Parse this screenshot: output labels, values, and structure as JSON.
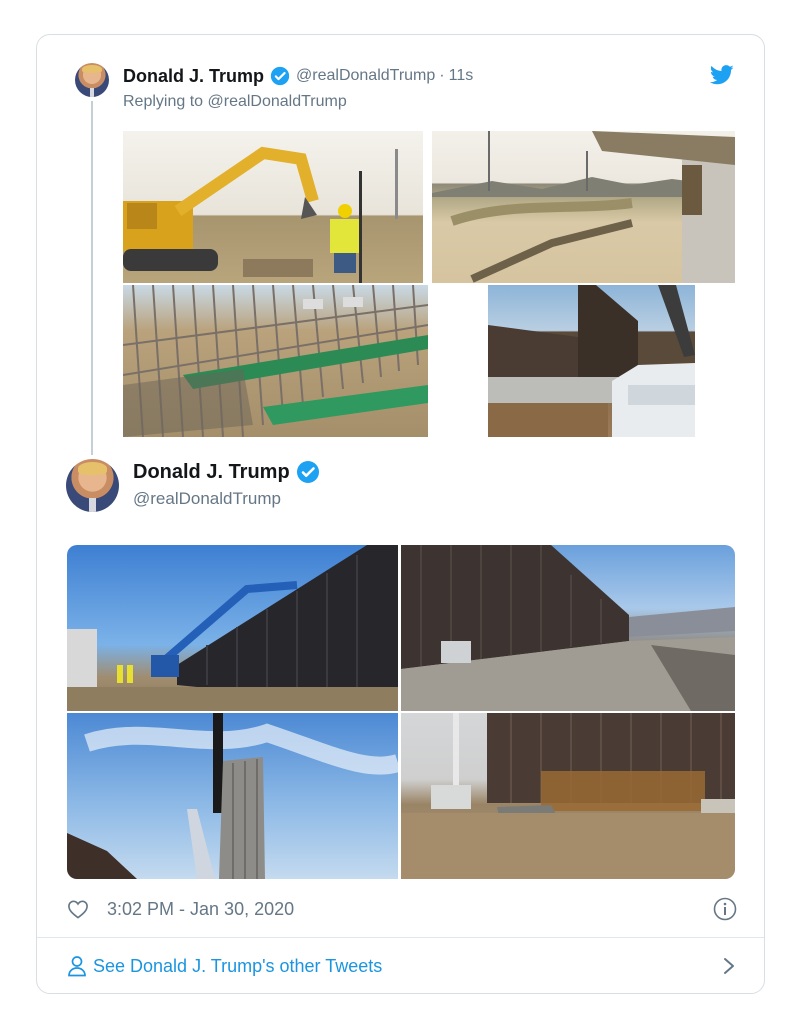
{
  "quoted_tweet": {
    "author_name": "Donald J. Trump",
    "author_handle": "@realDonaldTrump",
    "separator": "·",
    "relative_time": "11s",
    "replying_to": "Replying to @realDonaldTrump",
    "photos": [
      "excavator-photo",
      "desert-trench-photo",
      "rebar-frame-photo",
      "wall-truck-photo"
    ]
  },
  "main_tweet": {
    "author_name": "Donald J. Trump",
    "author_handle": "@realDonaldTrump",
    "photos": [
      "crane-wall-photo",
      "wall-road-photo",
      "bollard-lift-photo",
      "wall-crew-photo"
    ]
  },
  "footer": {
    "timestamp": "3:02 PM - Jan 30, 2020"
  },
  "see_more": {
    "label": "See Donald J. Trump's other Tweets"
  },
  "colors": {
    "brand": "#1da1f2",
    "link": "#1b95e0",
    "muted": "#657786",
    "border": "#d8dee3"
  },
  "icons": [
    "verified-badge-icon",
    "twitter-bird-icon",
    "heart-icon",
    "info-icon",
    "person-icon",
    "chevron-right-icon"
  ]
}
